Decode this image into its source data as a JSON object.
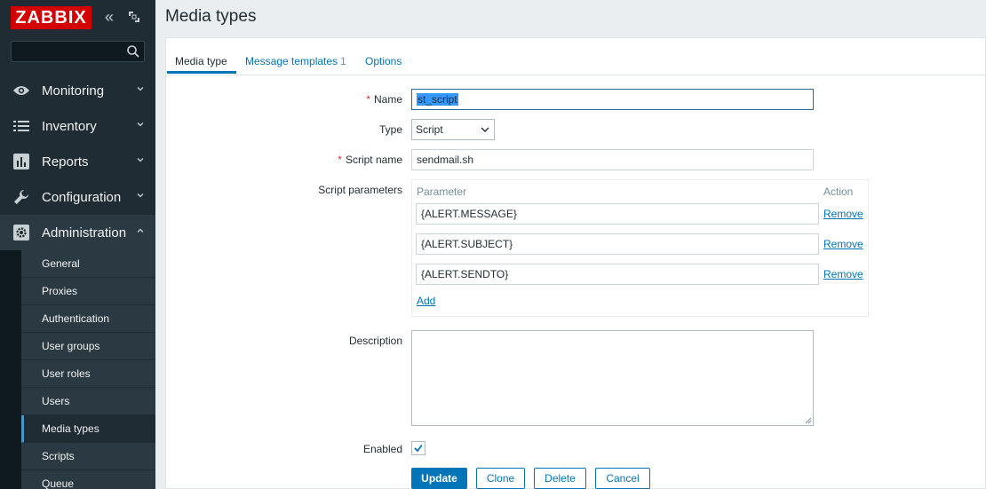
{
  "brand": {
    "logo": "ZABBIX",
    "collapse_icon": "«",
    "logo_color": "#d40000"
  },
  "search": {
    "placeholder": ""
  },
  "sidebar": {
    "menu": [
      {
        "label": "Monitoring",
        "icon": "eye-icon"
      },
      {
        "label": "Inventory",
        "icon": "list-icon"
      },
      {
        "label": "Reports",
        "icon": "bar-chart-icon"
      },
      {
        "label": "Configuration",
        "icon": "wrench-icon"
      },
      {
        "label": "Administration",
        "icon": "gear-icon"
      }
    ],
    "submenu": [
      {
        "label": "General"
      },
      {
        "label": "Proxies"
      },
      {
        "label": "Authentication"
      },
      {
        "label": "User groups"
      },
      {
        "label": "User roles"
      },
      {
        "label": "Users"
      },
      {
        "label": "Media types"
      },
      {
        "label": "Scripts"
      },
      {
        "label": "Queue"
      }
    ],
    "active_submenu": "Media types"
  },
  "page": {
    "title": "Media types"
  },
  "tabs": [
    {
      "label": "Media type"
    },
    {
      "label": "Message templates",
      "count": "1"
    },
    {
      "label": "Options"
    }
  ],
  "form": {
    "name_label": "Name",
    "name_value": "st_script",
    "type_label": "Type",
    "type_value": "Script",
    "script_name_label": "Script name",
    "script_name_value": "sendmail.sh",
    "script_params_label": "Script parameters",
    "params_header": {
      "parameter": "Parameter",
      "action": "Action"
    },
    "params": [
      {
        "value": "{ALERT.MESSAGE}",
        "action": "Remove"
      },
      {
        "value": "{ALERT.SUBJECT}",
        "action": "Remove"
      },
      {
        "value": "{ALERT.SENDTO}",
        "action": "Remove"
      }
    ],
    "add_label": "Add",
    "description_label": "Description",
    "description_value": "",
    "enabled_label": "Enabled",
    "enabled": true,
    "buttons": {
      "update": "Update",
      "clone": "Clone",
      "delete": "Delete",
      "cancel": "Cancel"
    }
  },
  "colors": {
    "accent": "#0275b8",
    "sidebar_bg": "#1f2c33",
    "required": "#e33734"
  }
}
